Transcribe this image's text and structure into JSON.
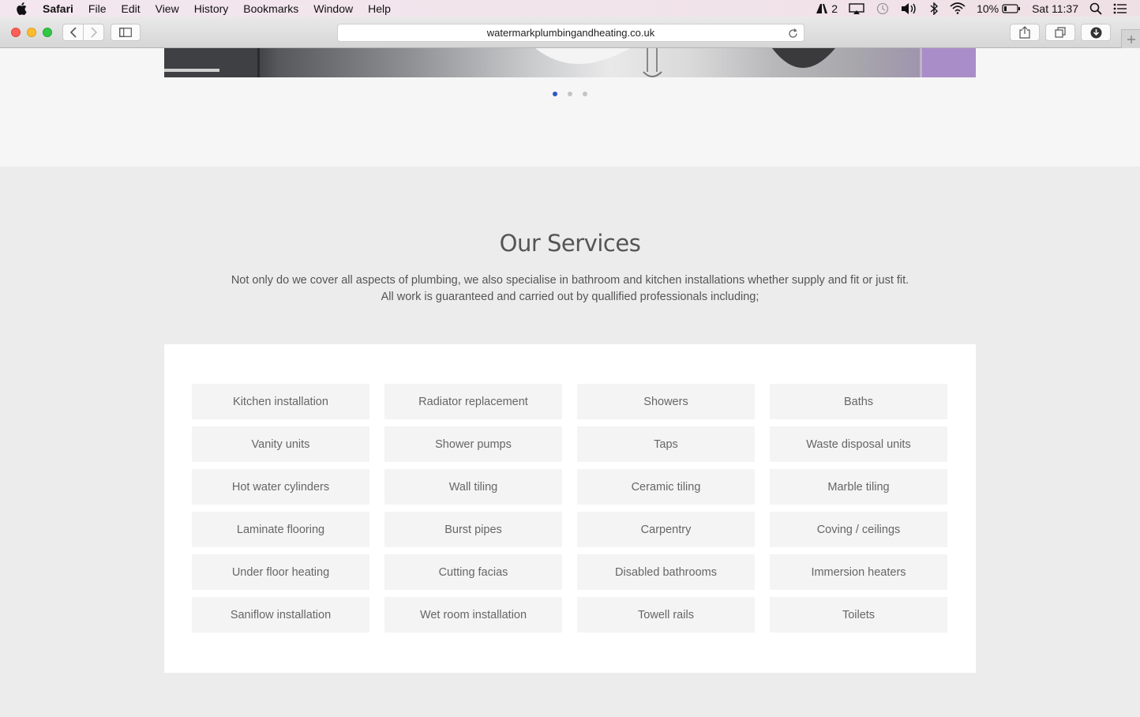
{
  "menubar": {
    "app_name": "Safari",
    "items": [
      "File",
      "Edit",
      "View",
      "History",
      "Bookmarks",
      "Window",
      "Help"
    ],
    "status": {
      "adobe_count": "2",
      "battery": "10%",
      "clock": "Sat 11:37"
    }
  },
  "browser": {
    "url": "watermarkplumbingandheating.co.uk"
  },
  "carousel": {
    "slide_count": 3,
    "active_index": 0
  },
  "services": {
    "title": "Our Services",
    "description_line1": "Not only do we cover all aspects of plumbing, we also specialise in bathroom and kitchen installations whether supply and fit or just fit.",
    "description_line2": "All work is guaranteed and carried out by quallified professionals including;",
    "items": [
      "Kitchen installation",
      "Radiator replacement",
      "Showers",
      "Baths",
      "Vanity units",
      "Shower pumps",
      "Taps",
      "Waste disposal units",
      "Hot water cylinders",
      "Wall tiling",
      "Ceramic tiling",
      "Marble tiling",
      "Laminate flooring",
      "Burst pipes",
      "Carpentry",
      "Coving / ceilings",
      "Under floor heating",
      "Cutting facias",
      "Disabled bathrooms",
      "Immersion heaters",
      "Saniflow installation",
      "Wet room installation",
      "Towell rails",
      "Toilets"
    ]
  },
  "colors": {
    "accent_dot": "#2d56c9",
    "panel_bg": "#ffffff",
    "tile_bg": "#f4f4f4"
  }
}
